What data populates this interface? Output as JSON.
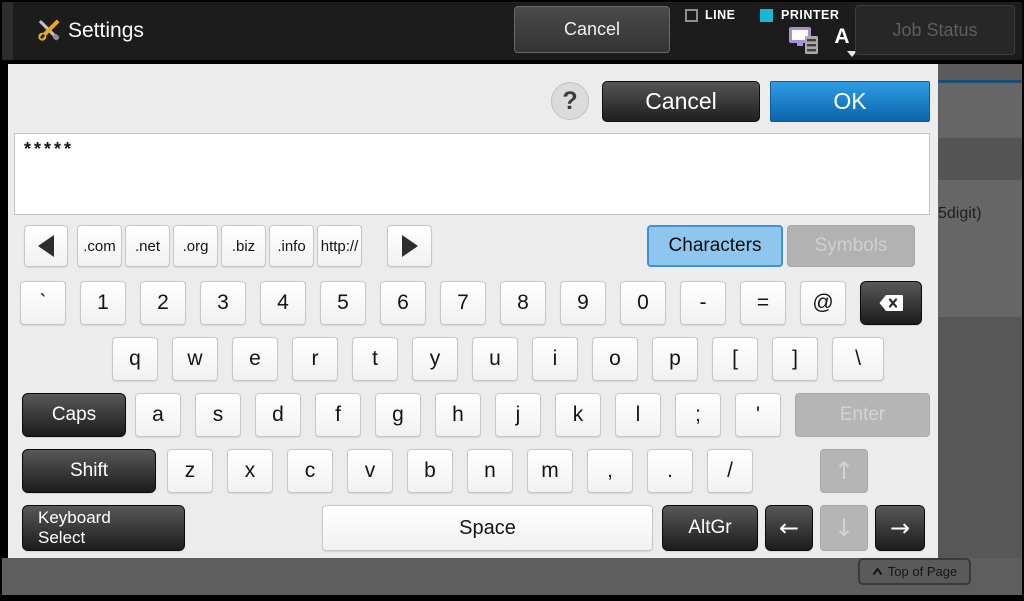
{
  "top_bar": {
    "title": "Settings",
    "cancel_label": "Cancel",
    "line_label": "LINE",
    "printer_label": "PRINTER",
    "font_indicator": "A",
    "job_status_label": "Job Status"
  },
  "dialog": {
    "help_label": "?",
    "cancel_label": "Cancel",
    "ok_label": "OK",
    "input_value": "*****",
    "url_keys": [
      ".com",
      ".net",
      ".org",
      ".biz",
      ".info",
      "http://"
    ],
    "tabs": {
      "characters_label": "Characters",
      "symbols_label": "Symbols"
    },
    "keyboard": {
      "row1": [
        "`",
        "1",
        "2",
        "3",
        "4",
        "5",
        "6",
        "7",
        "8",
        "9",
        "0",
        "-",
        "=",
        "@"
      ],
      "row2": [
        "q",
        "w",
        "e",
        "r",
        "t",
        "y",
        "u",
        "i",
        "o",
        "p",
        "[",
        "]",
        "\\"
      ],
      "row3": [
        "a",
        "s",
        "d",
        "f",
        "g",
        "h",
        "j",
        "k",
        "l",
        ";",
        "'"
      ],
      "row4": [
        "z",
        "x",
        "c",
        "v",
        "b",
        "n",
        "m",
        ",",
        ".",
        "/"
      ],
      "caps_label": "Caps",
      "shift_label": "Shift",
      "enter_label": "Enter",
      "keyboard_select_label": "Keyboard\nSelect",
      "space_label": "Space",
      "altgr_label": "AltGr",
      "arrows": {
        "up": "↑",
        "down": "↓",
        "left": "←",
        "right": "→"
      }
    }
  },
  "background_page": {
    "partial_text": "5digit)",
    "top_of_page_label": "Top of Page"
  },
  "colors": {
    "ok_button": "#1178c0",
    "characters_active_bg": "#8fc6ef",
    "characters_active_border": "#3e93d8",
    "printer_indicator": "#18b7d4",
    "accent_line": "#1c4d78",
    "topbar_bg": "#1c1c1c",
    "dialog_bg": "#ececec"
  }
}
